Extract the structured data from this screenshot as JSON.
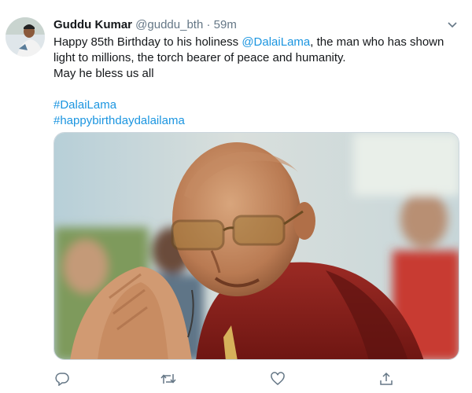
{
  "tweet": {
    "author": {
      "name": "Guddu Kumar",
      "handle": "@guddu_bth",
      "separator": "·",
      "timestamp": "59m"
    },
    "body": {
      "line1_prefix": "Happy 85th Birthday to his holiness ",
      "mention": "@DalaiLama",
      "line1_suffix": ", the man who has shown",
      "line2": "light to millions, the torch bearer of peace and humanity.",
      "line3": "May he bless us all"
    },
    "hashtags": [
      "#DalaiLama",
      "#happybirthdaydalailama"
    ],
    "icons": {
      "menu": "chevron-down-icon",
      "reply": "reply-icon",
      "retweet": "retweet-icon",
      "like": "like-icon",
      "share": "share-icon"
    },
    "colors": {
      "link": "#1b95e0",
      "secondary_text": "#657786",
      "primary_text": "#14171a"
    }
  }
}
